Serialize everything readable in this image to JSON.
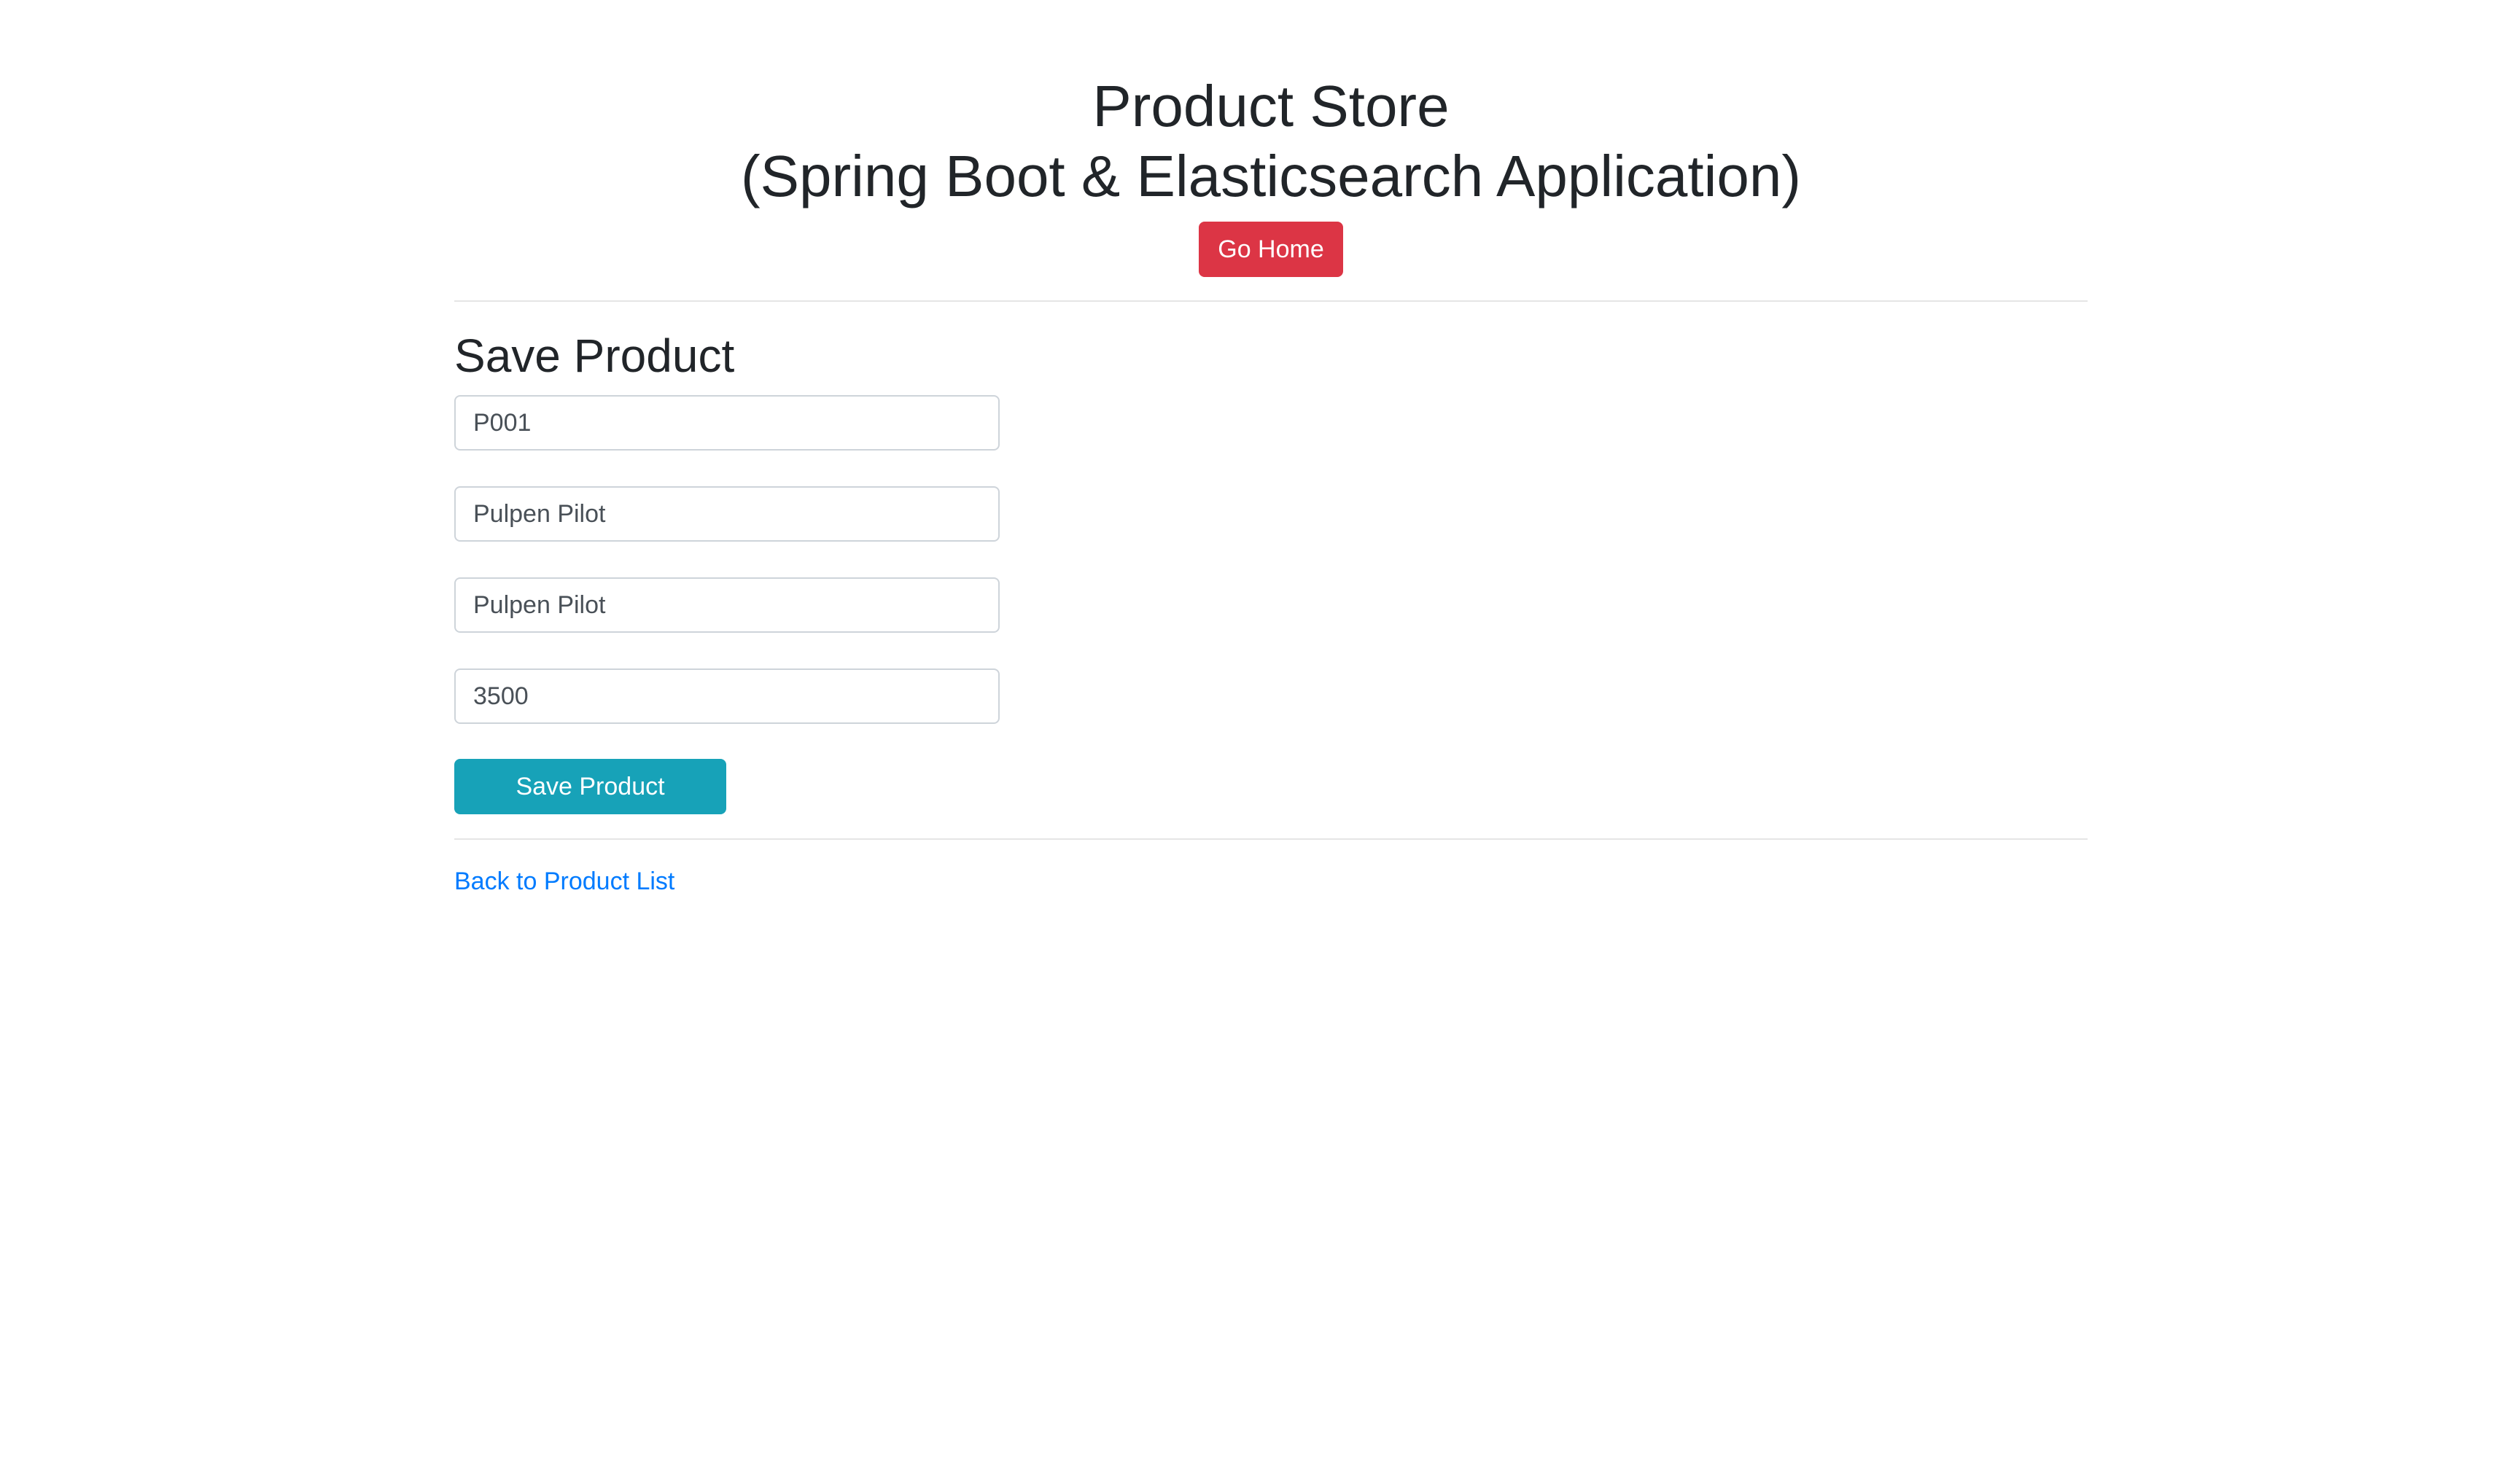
{
  "header": {
    "title_line1": "Product Store",
    "title_line2": "(Spring Boot & Elasticsearch Application)",
    "home_button_label": "Go Home"
  },
  "form": {
    "title": "Save Product",
    "fields": [
      {
        "value": "P001"
      },
      {
        "value": "Pulpen Pilot"
      },
      {
        "value": "Pulpen Pilot"
      },
      {
        "value": "3500"
      }
    ],
    "submit_label": "Save Product"
  },
  "footer": {
    "back_link_label": "Back to Product List"
  },
  "colors": {
    "danger": "#dc3545",
    "info": "#17a2b8",
    "link": "#007bff",
    "text": "#212529"
  }
}
